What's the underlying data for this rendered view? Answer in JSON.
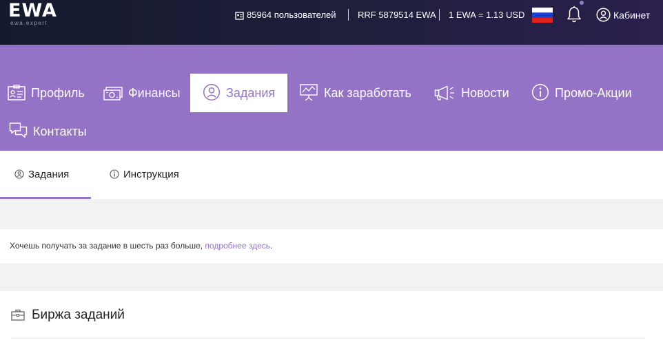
{
  "header": {
    "logo_text": "EWA",
    "logo_sub": "ewa.expert",
    "users_count": "85964 пользователей",
    "rrf": "RRF 5879514 EWA",
    "rate": "1 EWA = 1.13 USD",
    "cabinet_label": "Кабинет",
    "language_flag": "ru-flag-icon",
    "colors": {
      "accent": "#9473c6",
      "header_bg": "#1c1d36"
    }
  },
  "nav": {
    "items": [
      {
        "label": "Профиль",
        "icon": "profile-card-icon"
      },
      {
        "label": "Финансы",
        "icon": "money-icon"
      },
      {
        "label": "Задания",
        "icon": "user-circle-icon",
        "active": true
      },
      {
        "label": "Как заработать",
        "icon": "presentation-icon"
      },
      {
        "label": "Новости",
        "icon": "megaphone-icon"
      },
      {
        "label": "Промо-Акции",
        "icon": "info-icon"
      },
      {
        "label": "Контакты",
        "icon": "chat-icon"
      }
    ]
  },
  "subtabs": {
    "items": [
      {
        "label": "Задания",
        "icon": "user-circle-icon",
        "active": true
      },
      {
        "label": "Инструкция",
        "icon": "info-icon"
      }
    ]
  },
  "notice": {
    "text": "Хочешь получать за задание в шесть раз больше, ",
    "link": "подробнее здесь",
    "suffix": "."
  },
  "panel": {
    "title": "Биржа заданий",
    "icon": "briefcase-icon"
  }
}
